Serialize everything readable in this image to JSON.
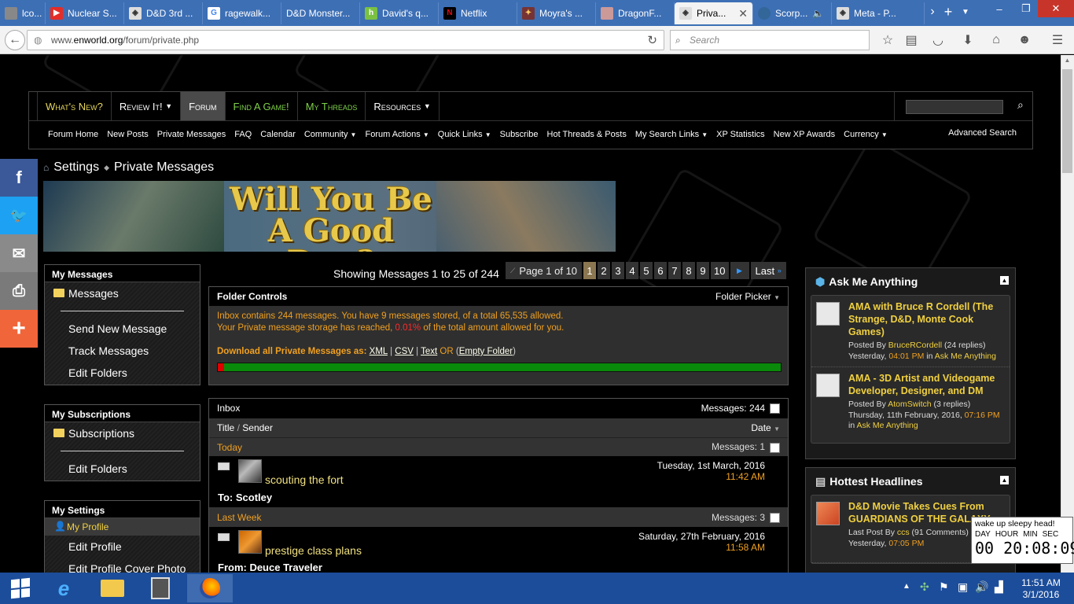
{
  "browser": {
    "tabs": [
      {
        "label": "lco...",
        "icon": "tab-site-icon"
      },
      {
        "label": "Nuclear S...",
        "icon": "youtube-icon"
      },
      {
        "label": "D&D 3rd ...",
        "icon": "tab-site-icon"
      },
      {
        "label": "ragewalk...",
        "icon": "google-icon"
      },
      {
        "label": "D&D Monster...",
        "icon": "tab-site-icon"
      },
      {
        "label": "David's q...",
        "icon": "houzz-icon"
      },
      {
        "label": "Netflix",
        "icon": "netflix-icon"
      },
      {
        "label": "Moyra's ...",
        "icon": "tab-site-icon"
      },
      {
        "label": "DragonF...",
        "icon": "tab-site-icon"
      },
      {
        "label": "Priva...",
        "icon": "enworld-icon"
      },
      {
        "label": "Scorp...",
        "icon": "tab-site-icon"
      },
      {
        "label": "Meta - P...",
        "icon": "enworld-icon"
      }
    ],
    "url_prefix": "www.",
    "url_domain": "enworld.org",
    "url_path": "/forum/private.php",
    "search_placeholder": "Search"
  },
  "site_nav": {
    "primary": [
      "What's New?",
      "Review It!",
      "Forum",
      "Find A Game!",
      "My Threads",
      "Resources"
    ],
    "secondary": [
      "Forum Home",
      "New Posts",
      "Private Messages",
      "FAQ",
      "Calendar",
      "Community",
      "Forum Actions",
      "Quick Links",
      "Subscribe",
      "Hot Threads & Posts",
      "My Search Links",
      "XP Statistics",
      "New XP Awards",
      "Currency"
    ],
    "advanced_search": "Advanced Search"
  },
  "breadcrumb": {
    "settings": "Settings",
    "current": "Private Messages"
  },
  "banner": {
    "line1": "Will You Be",
    "line2": "A Good Dog?"
  },
  "sidebar": {
    "my_messages": {
      "title": "My Messages",
      "folder": "Messages",
      "items": [
        "Send New Message",
        "Track Messages",
        "Edit Folders"
      ]
    },
    "my_subscriptions": {
      "title": "My Subscriptions",
      "folder": "Subscriptions",
      "items": [
        "Edit Folders"
      ]
    },
    "my_settings": {
      "title": "My Settings",
      "profile": "My Profile",
      "items": [
        "Edit Profile",
        "Edit Profile Cover Photo"
      ]
    }
  },
  "pagination": {
    "showing": "Showing Messages 1 to 25 of 244",
    "page_label": "Page 1 of 10",
    "pages": [
      "1",
      "2",
      "3",
      "4",
      "5",
      "6",
      "7",
      "8",
      "9",
      "10"
    ],
    "last": "Last"
  },
  "folder_controls": {
    "title": "Folder Controls",
    "picker": "Folder Picker",
    "line1": "Inbox contains 244 messages. You have 9 messages stored, of a total 65,535 allowed.",
    "line2_a": "Your Private message storage has reached, ",
    "line2_pct": "0.01%",
    "line2_b": " of the total amount allowed for you.",
    "download_label": "Download all Private Messages as",
    "xml": "XML",
    "csv": "CSV",
    "text": "Text",
    "or": "OR",
    "empty": "Empty Folder",
    "storage_fraction": 0.0109
  },
  "inbox": {
    "title": "Inbox",
    "count_label": "Messages: 244",
    "col_title": "Title",
    "col_sender": "Sender",
    "col_date": "Date",
    "groups": [
      {
        "name": "Today",
        "count": "Messages: 1",
        "msg": {
          "title": "scouting the fort",
          "date": "Tuesday, 1st March, 2016",
          "time": "11:42 AM",
          "who": "To: Scotley"
        }
      },
      {
        "name": "Last Week",
        "count": "Messages: 3",
        "msg": {
          "title": "prestige class plans",
          "date": "Saturday, 27th February, 2016",
          "time": "11:58 AM",
          "who": "From: Deuce Traveler"
        }
      }
    ]
  },
  "ask_me_anything": {
    "title": "Ask Me Anything",
    "items": [
      {
        "title": "AMA with Bruce R Cordell (The Strange, D&D, Monte Cook Games)",
        "posted_by": "Posted By ",
        "author": "BruceRCordell",
        "replies": " (24 replies)",
        "date": "Yesterday, ",
        "time": "04:01 PM",
        "in": " in ",
        "forum": "Ask Me Anything"
      },
      {
        "title": "AMA - 3D Artist and Videogame Developer, Designer, and DM",
        "posted_by": "Posted By ",
        "author": "AtomSwitch",
        "replies": " (3 replies)",
        "date": "Thursday, 11th February, 2016, ",
        "time": "07:16 PM",
        "in": " in ",
        "forum": "Ask Me Anything"
      }
    ]
  },
  "hottest": {
    "title": "Hottest Headlines",
    "items": [
      {
        "title": "D&D Movie Takes Cues From GUARDIANS OF THE GALAXY",
        "posted_by": "Last Post By ",
        "author": "ccs",
        "replies": " (91 Comments)",
        "date": "Yesterday, ",
        "time": "07:05 PM"
      }
    ]
  },
  "clock": {
    "message": "wake up sleepy head!",
    "labels": [
      "DAY",
      "HOUR",
      "MIN",
      "SEC"
    ],
    "day": "00",
    "time": "20:08:09"
  },
  "taskbar": {
    "time": "11:51 AM",
    "date": "3/1/2016"
  },
  "colors": {
    "accent_orange": "#f0a020",
    "title_yellow": "#f0d040",
    "nav_green": "#7fd14a",
    "storage_green": "#0a8a0a",
    "storage_red": "#e00000"
  }
}
